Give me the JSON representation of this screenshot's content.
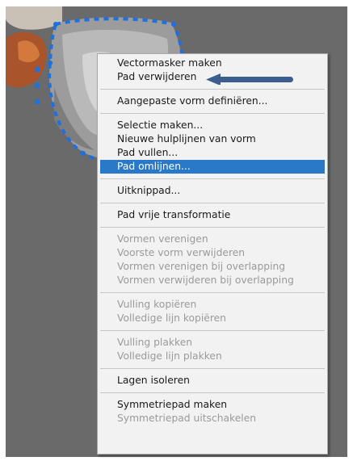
{
  "context_menu": {
    "groups": [
      {
        "items": [
          {
            "label": "Vectormasker maken",
            "enabled": true
          },
          {
            "label": "Pad verwijderen",
            "enabled": true
          }
        ]
      },
      {
        "items": [
          {
            "label": "Aangepaste vorm definiëren...",
            "enabled": true
          }
        ]
      },
      {
        "items": [
          {
            "label": "Selectie maken...",
            "enabled": true
          },
          {
            "label": "Nieuwe hulplijnen van vorm",
            "enabled": true
          },
          {
            "label": "Pad vullen...",
            "enabled": true
          },
          {
            "label": "Pad omlijnen...",
            "enabled": true,
            "highlighted": true
          }
        ]
      },
      {
        "items": [
          {
            "label": "Uitknippad...",
            "enabled": true
          }
        ]
      },
      {
        "items": [
          {
            "label": "Pad vrije transformatie",
            "enabled": true
          }
        ]
      },
      {
        "items": [
          {
            "label": "Vormen verenigen",
            "enabled": false
          },
          {
            "label": "Voorste vorm verwijderen",
            "enabled": false
          },
          {
            "label": "Vormen verenigen bij overlapping",
            "enabled": false
          },
          {
            "label": "Vormen verwijderen bij overlapping",
            "enabled": false
          }
        ]
      },
      {
        "items": [
          {
            "label": "Vulling kopiëren",
            "enabled": false
          },
          {
            "label": "Volledige lijn kopiëren",
            "enabled": false
          }
        ]
      },
      {
        "items": [
          {
            "label": "Vulling plakken",
            "enabled": false
          },
          {
            "label": "Volledige lijn plakken",
            "enabled": false
          }
        ]
      },
      {
        "items": [
          {
            "label": "Lagen isoleren",
            "enabled": true
          }
        ]
      },
      {
        "items": [
          {
            "label": "Symmetriepad maken",
            "enabled": true
          },
          {
            "label": "Symmetriepad uitschakelen",
            "enabled": false
          }
        ]
      }
    ]
  },
  "colors": {
    "canvas_background": "#6a6a6a",
    "highlight": "#2a78c8",
    "path_outline": "#1e6fe0",
    "annotation_arrow": "#3a5f8f"
  },
  "icons": {
    "annotation": "arrow-left-icon"
  }
}
